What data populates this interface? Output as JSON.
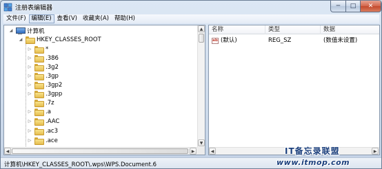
{
  "window": {
    "title": "注册表编辑器",
    "minimize_glyph": "─",
    "maximize_glyph": "□",
    "close_glyph": "✕",
    "icons": [
      "registry-editor-icon",
      "minimize-icon",
      "maximize-icon",
      "close-icon"
    ]
  },
  "menu": {
    "items": [
      {
        "label": "文件(F)",
        "active": false
      },
      {
        "label": "编辑(E)",
        "active": true
      },
      {
        "label": "查看(V)",
        "active": false
      },
      {
        "label": "收藏夹(A)",
        "active": false
      },
      {
        "label": "帮助(H)",
        "active": false
      }
    ]
  },
  "tree": {
    "root": {
      "label": "计算机",
      "expander": "◢",
      "icon": "computer-icon"
    },
    "hive": {
      "label": "HKEY_CLASSES_ROOT",
      "expander": "◢",
      "icon": "folder-icon"
    },
    "expander_collapsed": "▷",
    "keys": [
      {
        "label": "*",
        "has_children": true
      },
      {
        "label": ".386",
        "has_children": true
      },
      {
        "label": ".3g2",
        "has_children": true
      },
      {
        "label": ".3gp",
        "has_children": true
      },
      {
        "label": ".3gp2",
        "has_children": true
      },
      {
        "label": ".3gpp",
        "has_children": true
      },
      {
        "label": ".7z",
        "has_children": false
      },
      {
        "label": ".a",
        "has_children": true
      },
      {
        "label": ".AAC",
        "has_children": true
      },
      {
        "label": ".ac3",
        "has_children": true
      },
      {
        "label": ".ace",
        "has_children": true
      }
    ]
  },
  "list": {
    "columns": [
      "名称",
      "类型",
      "数据"
    ],
    "rows": [
      {
        "icon": "string-value-icon",
        "icon_text": "ab",
        "name": "(默认)",
        "type": "REG_SZ",
        "data": "(数值未设置)"
      }
    ]
  },
  "scrollbar": {
    "up": "▲",
    "down": "▼",
    "left": "◀",
    "right": "▶"
  },
  "status": {
    "path": "计算机\\HKEY_CLASSES_ROOT\\.wps\\WPS.Document.6"
  },
  "watermark": {
    "line1": "IT备忘录联盟",
    "line2": "www.itmop.com"
  }
}
